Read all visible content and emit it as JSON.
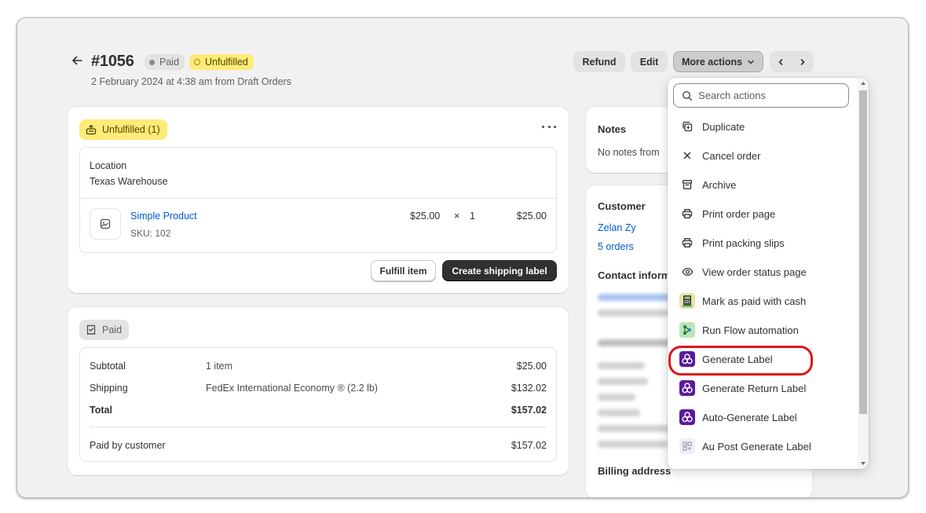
{
  "header": {
    "order_number": "#1056",
    "paid_badge": "Paid",
    "unfulfilled_badge": "Unfulfilled",
    "subtitle": "2 February 2024 at 4:38 am from Draft Orders",
    "refund": "Refund",
    "edit": "Edit",
    "more_actions": "More actions"
  },
  "fulfillment": {
    "status": "Unfulfilled (1)",
    "location_label": "Location",
    "location_value": "Texas Warehouse",
    "product_name": "Simple Product",
    "sku": "SKU: 102",
    "price": "$25.00",
    "times": "×",
    "quantity": "1",
    "line_total": "$25.00",
    "fulfill_button": "Fulfill item",
    "shipping_button": "Create shipping label"
  },
  "payment": {
    "status": "Paid",
    "rows": [
      {
        "label": "Subtotal",
        "detail": "1 item",
        "amount": "$25.00"
      },
      {
        "label": "Shipping",
        "detail": "FedEx International Economy ® (2.2 lb)",
        "amount": "$132.02"
      },
      {
        "label": "Total",
        "detail": "",
        "amount": "$157.02"
      }
    ],
    "paid_by_label": "Paid by customer",
    "paid_by_amount": "$157.02"
  },
  "notes": {
    "title": "Notes",
    "text": "No notes from"
  },
  "customer": {
    "title": "Customer",
    "name": "Zelan Zy",
    "orders": "5 orders",
    "contact_title": "Contact inform",
    "billing_title": "Billing address"
  },
  "menu": {
    "search_placeholder": "Search actions",
    "items": [
      {
        "label": "Duplicate",
        "icon": "duplicate-icon"
      },
      {
        "label": "Cancel order",
        "icon": "x-icon"
      },
      {
        "label": "Archive",
        "icon": "archive-icon"
      },
      {
        "label": "Print order page",
        "icon": "printer-icon"
      },
      {
        "label": "Print packing slips",
        "icon": "printer-icon"
      },
      {
        "label": "View order status page",
        "icon": "eye-icon"
      },
      {
        "label": "Mark as paid with cash",
        "icon": "cash-app-icon"
      },
      {
        "label": "Run Flow automation",
        "icon": "flow-app-icon"
      },
      {
        "label": "Generate Label",
        "icon": "label-app-icon",
        "highlighted": true
      },
      {
        "label": "Generate Return Label",
        "icon": "label-app-icon"
      },
      {
        "label": "Auto-Generate Label",
        "icon": "label-app-icon"
      },
      {
        "label": "Au Post Generate Label",
        "icon": "aupost-app-icon"
      }
    ]
  },
  "colors": {
    "accent_link": "#005bd3",
    "unfulfilled_bg": "#ffeb78",
    "highlight_ring": "#e0131d",
    "label_app": "#5b1a9e"
  }
}
